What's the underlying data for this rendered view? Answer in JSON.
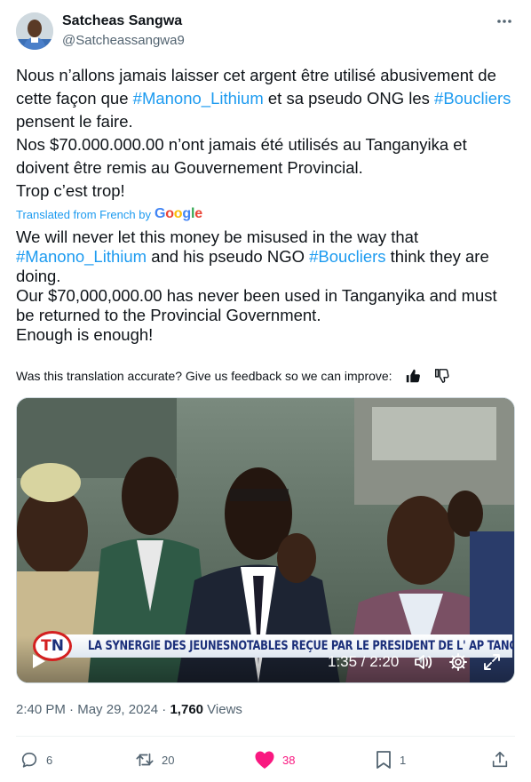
{
  "author": {
    "display_name": "Satcheas Sangwa",
    "handle": "@Satcheassangwa9"
  },
  "tweet": {
    "line1_a": "Nous n’allons jamais laisser cet argent être utilisé abusivement de cette façon que ",
    "hashtag1": "#Manono_Lithium",
    "line1_b": " et sa pseudo ONG les ",
    "hashtag2": "#Boucliers",
    "line1_c": " pensent le faire.",
    "line2": "Nos $70.000.000.00 n’ont jamais été utilisés au Tanganyika et doivent être remis au Gouvernement Provincial.",
    "line3": "Trop c’est trop!"
  },
  "translation": {
    "label": "Translated from French by",
    "provider": "Google",
    "line1_a": "We will never let this money be misused in the way that ",
    "hashtag1": "#Manono_Lithium",
    "line1_b": " and his pseudo NGO ",
    "hashtag2": "#Boucliers",
    "line1_c": " think they are doing.",
    "line2": "Our $70,000,000.00 has never been used in Tanganyika and must be returned to the Provincial Government.",
    "line3": "Enough is enough!",
    "feedback_prompt": "Was this translation accurate? Give us feedback so we can improve:"
  },
  "video": {
    "logo_t": "T",
    "logo_n": "N",
    "banner": "LA SYNERGIE DES JEUNESNOTABLES REÇUE PAR LE PRESIDENT DE L' AP TANG",
    "time": "1:35 / 2:20",
    "icons": [
      "play-icon",
      "volume-icon",
      "settings-icon",
      "fullscreen-icon"
    ]
  },
  "meta": {
    "time": "2:40 PM",
    "sep1": " · ",
    "date": "May 29, 2024",
    "sep2": " · ",
    "views_count": "1,760",
    "views_label": " Views"
  },
  "actions": {
    "replies": "6",
    "reposts": "20",
    "likes": "38",
    "bookmarks": "1"
  },
  "colors": {
    "accent": "#1d9bf0",
    "like": "#f91880",
    "secondary_text": "#536471"
  }
}
